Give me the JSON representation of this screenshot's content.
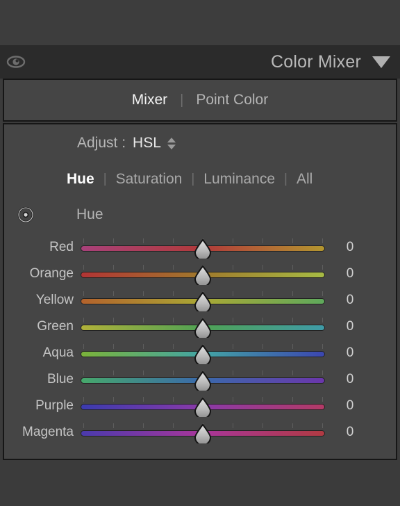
{
  "header": {
    "title": "Color Mixer",
    "eye_icon": "eye-icon",
    "collapse_icon": "triangle-down-icon"
  },
  "tabs": [
    {
      "label": "Mixer",
      "active": true
    },
    {
      "label": "Point Color",
      "active": false
    }
  ],
  "tab_separator": "|",
  "adjust": {
    "label": "Adjust :",
    "value": "HSL",
    "stepper_icon": "up-down-stepper-icon"
  },
  "modes": [
    {
      "label": "Hue",
      "active": true
    },
    {
      "label": "Saturation",
      "active": false
    },
    {
      "label": "Luminance",
      "active": false
    },
    {
      "label": "All",
      "active": false
    }
  ],
  "mode_separator": "|",
  "section": {
    "target_icon": "target-adjustment-icon",
    "title": "Hue"
  },
  "sliders": [
    {
      "name": "Red",
      "value": "0",
      "position": 50,
      "from": "#a8417a",
      "mid": "#b13a3a",
      "to": "#b3962f"
    },
    {
      "name": "Orange",
      "value": "0",
      "position": 50,
      "from": "#b23434",
      "mid": "#a07a2c",
      "to": "#a7bb44"
    },
    {
      "name": "Yellow",
      "value": "0",
      "position": 50,
      "from": "#b3622c",
      "mid": "#a9a835",
      "to": "#5fa95c"
    },
    {
      "name": "Green",
      "value": "0",
      "position": 50,
      "from": "#b0b13a",
      "mid": "#4fa254",
      "to": "#3f9ba8"
    },
    {
      "name": "Aqua",
      "value": "0",
      "position": 50,
      "from": "#7bb33a",
      "mid": "#43a5a5",
      "to": "#3b46b0"
    },
    {
      "name": "Blue",
      "value": "0",
      "position": 50,
      "from": "#46a86b",
      "mid": "#3a69ab",
      "to": "#6b36ab"
    },
    {
      "name": "Purple",
      "value": "0",
      "position": 50,
      "from": "#3b3bae",
      "mid": "#8a3aa8",
      "to": "#b33a66"
    },
    {
      "name": "Magenta",
      "value": "0",
      "position": 50,
      "from": "#4a3aad",
      "mid": "#a8369a",
      "to": "#b03a42"
    }
  ],
  "colors": {
    "panel_bg": "#454545",
    "header_bg": "#2b2b2b",
    "page_bg": "#3b3b3b",
    "border": "#161616",
    "text": "#c5c5c5",
    "text_active": "#ffffff"
  }
}
